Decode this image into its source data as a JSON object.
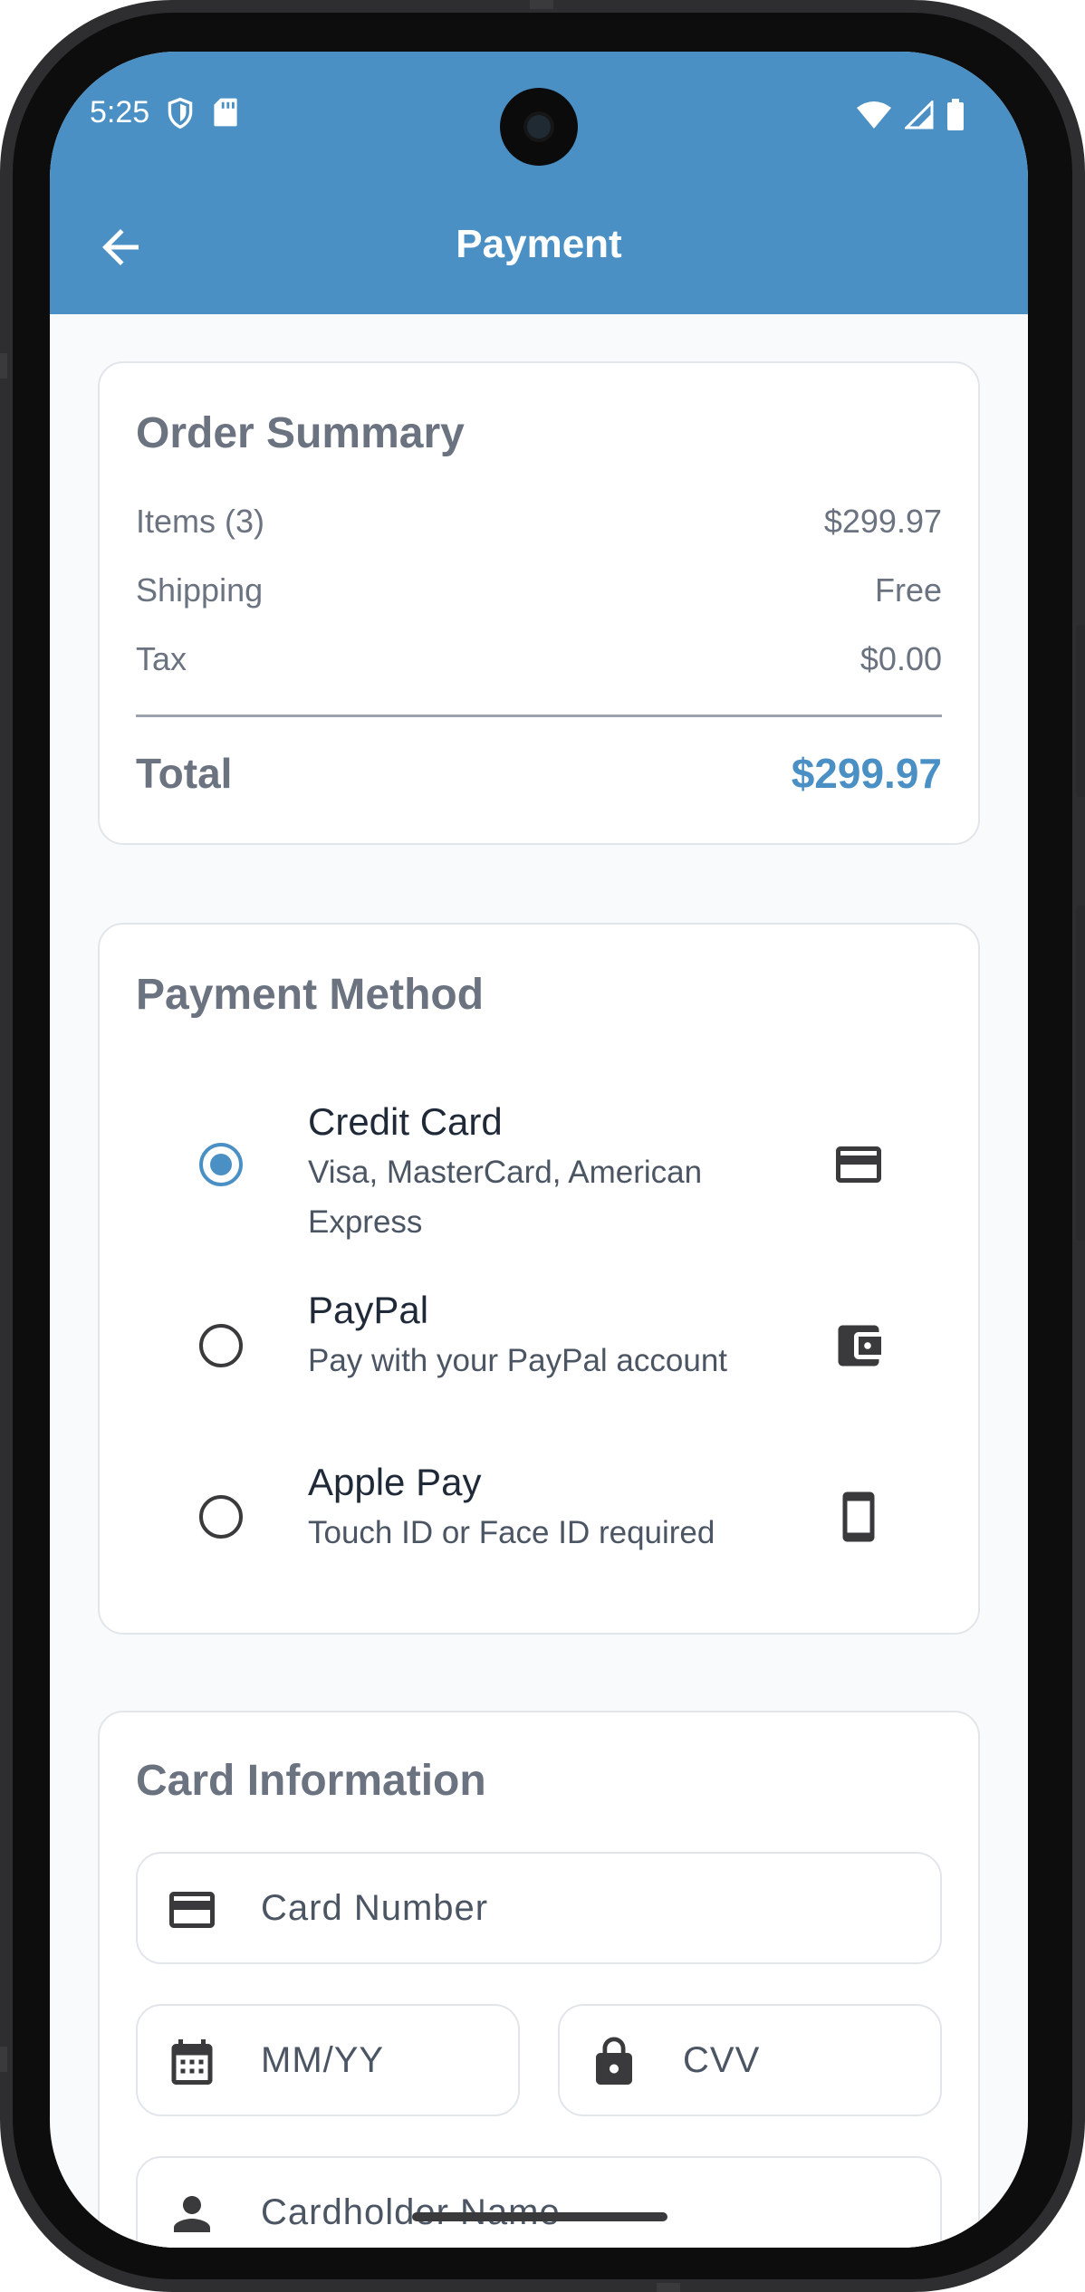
{
  "status_bar": {
    "time": "5:25",
    "icons_left": [
      "shield-icon",
      "sd-card-icon"
    ],
    "icons_right": [
      "wifi-icon",
      "cellular-signal-icon",
      "battery-icon"
    ]
  },
  "appbar": {
    "title": "Payment",
    "back_icon": "arrow-back-icon",
    "color": "#4a90c4"
  },
  "order_summary": {
    "title": "Order Summary",
    "rows": [
      {
        "label": "Items (3)",
        "value": "$299.97"
      },
      {
        "label": "Shipping",
        "value": "Free"
      },
      {
        "label": "Tax",
        "value": "$0.00"
      }
    ],
    "total_label": "Total",
    "total_value": "$299.97"
  },
  "payment_method": {
    "title": "Payment Method",
    "options": [
      {
        "title": "Credit Card",
        "subtitle": "Visa, MasterCard, American Express",
        "icon": "credit-card-icon",
        "selected": true
      },
      {
        "title": "PayPal",
        "subtitle": "Pay with your PayPal account",
        "icon": "wallet-icon",
        "selected": false
      },
      {
        "title": "Apple Pay",
        "subtitle": "Touch ID or Face ID required",
        "icon": "smartphone-icon",
        "selected": false
      }
    ]
  },
  "card_information": {
    "title": "Card Information",
    "fields": {
      "card_number": {
        "placeholder": "Card Number",
        "value": "",
        "icon": "credit-card-icon"
      },
      "expiry": {
        "placeholder": "MM/YY",
        "value": "",
        "icon": "calendar-icon"
      },
      "cvv": {
        "placeholder": "CVV",
        "value": "",
        "icon": "lock-icon"
      },
      "cardholder": {
        "placeholder": "Cardholder Name",
        "value": "",
        "icon": "person-icon"
      }
    }
  },
  "colors": {
    "accent": "#4a90c4",
    "muted_text": "#6b7280",
    "background": "#f8fafc"
  }
}
